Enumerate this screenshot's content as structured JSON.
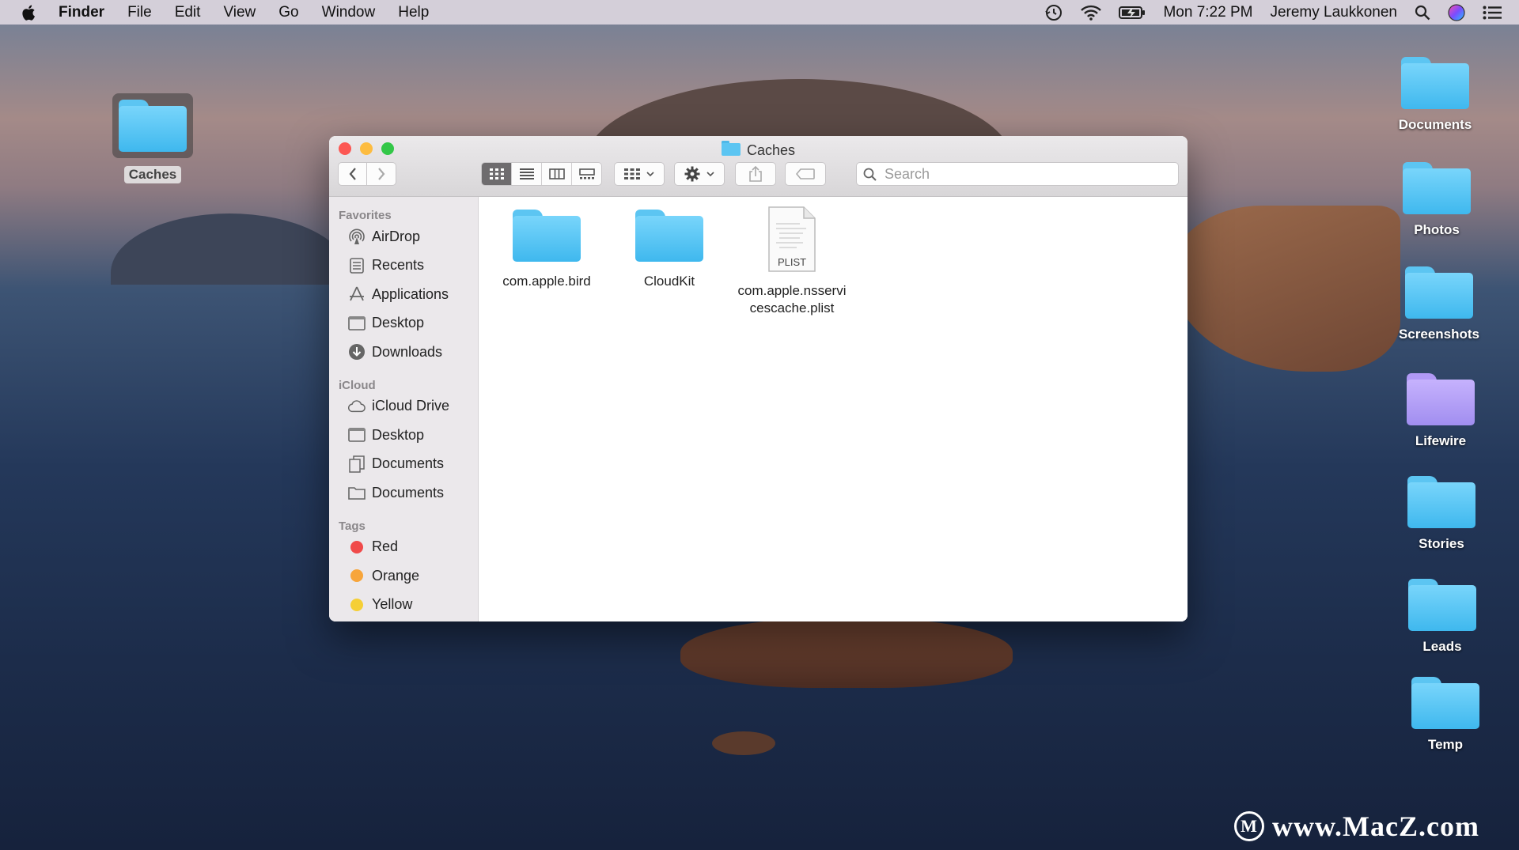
{
  "menubar": {
    "app": "Finder",
    "items": [
      "File",
      "Edit",
      "View",
      "Go",
      "Window",
      "Help"
    ],
    "clock": "Mon 7:22 PM",
    "user": "Jeremy Laukkonen"
  },
  "desktop": {
    "left_icon": "Caches",
    "right_icons": [
      "Documents",
      "Photos",
      "Screenshots",
      "Lifewire",
      "Stories",
      "Leads",
      "Temp"
    ]
  },
  "window": {
    "title": "Caches",
    "search_placeholder": "Search",
    "sidebar": {
      "favorites_header": "Favorites",
      "favorites": [
        {
          "label": "AirDrop",
          "icon": "airdrop-icon"
        },
        {
          "label": "Recents",
          "icon": "recents-icon"
        },
        {
          "label": "Applications",
          "icon": "applications-icon"
        },
        {
          "label": "Desktop",
          "icon": "desktop-icon"
        },
        {
          "label": "Downloads",
          "icon": "downloads-icon"
        }
      ],
      "icloud_header": "iCloud",
      "icloud": [
        {
          "label": "iCloud Drive",
          "icon": "cloud-icon"
        },
        {
          "label": "Desktop",
          "icon": "desktop-icon"
        },
        {
          "label": "Documents",
          "icon": "documents-icon"
        },
        {
          "label": "Documents",
          "icon": "folder-icon"
        }
      ],
      "tags_header": "Tags",
      "tags": [
        {
          "label": "Red",
          "color": "#f04a4a"
        },
        {
          "label": "Orange",
          "color": "#f7a53b"
        },
        {
          "label": "Yellow",
          "color": "#f5cf36"
        }
      ]
    },
    "files": [
      {
        "name": "com.apple.bird",
        "kind": "folder"
      },
      {
        "name": "CloudKit",
        "kind": "folder"
      },
      {
        "name": "com.apple.nsservi\ncescache.plist",
        "kind": "plist",
        "badge": "PLIST"
      }
    ]
  },
  "watermark": {
    "logo": "M",
    "text": "www.MacZ.com"
  },
  "colors": {
    "close": "#fc5753",
    "minimize": "#fdbc40",
    "zoom": "#33c748",
    "folder_blue": "#4fc0f0",
    "folder_purple": "#b7a3f8"
  }
}
